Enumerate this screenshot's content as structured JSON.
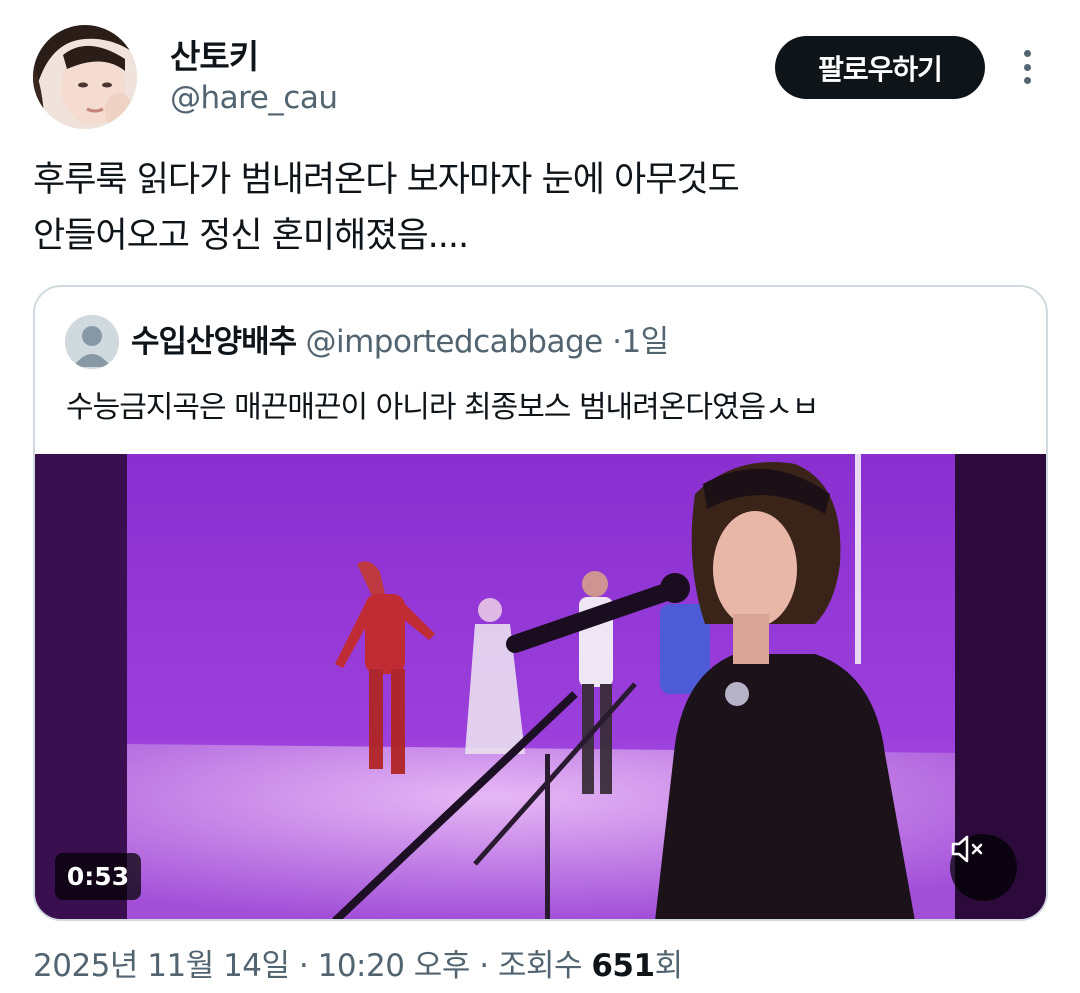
{
  "author": {
    "display_name": "산토키",
    "handle": "@hare_cau"
  },
  "follow_button": {
    "label": "팔로우하기"
  },
  "tweet": {
    "lines": [
      "후루룩 읽다가 범내려온다 보자마자 눈에 아무것도",
      "안들어오고 정신 혼미해졌음...."
    ]
  },
  "quote": {
    "display_name": "수입산양배추",
    "handle": "@importedcabbage",
    "separator": "·",
    "time": "1일",
    "text": "수능금지곡은 매끈매끈이 아니라 최종보스 범내려온다였음ㅅㅂ"
  },
  "video": {
    "duration": "0:53",
    "mute_icon": "speaker-muted-icon"
  },
  "meta": {
    "datetime": "2025년 11월 14일 · 10:20 오후",
    "separator": "·",
    "views_label": "조회수",
    "views_count": "651",
    "views_suffix": "회"
  },
  "colors": {
    "text_primary": "#0f1419",
    "text_secondary": "#536471",
    "border": "#cfd9de",
    "button_bg": "#0f1419",
    "video_purple": "#8a2fd0"
  }
}
